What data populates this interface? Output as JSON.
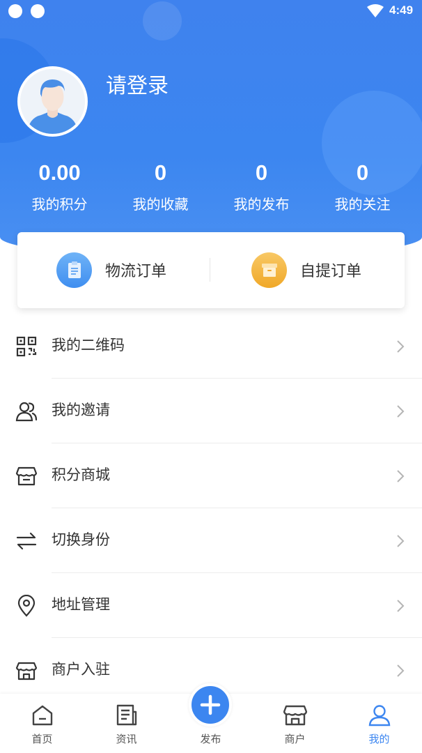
{
  "status_bar": {
    "time": "4:49"
  },
  "profile": {
    "login_text": "请登录"
  },
  "stats": [
    {
      "value": "0.00",
      "label": "我的积分"
    },
    {
      "value": "0",
      "label": "我的收藏"
    },
    {
      "value": "0",
      "label": "我的发布"
    },
    {
      "value": "0",
      "label": "我的关注"
    }
  ],
  "orders": {
    "logistics": {
      "label": "物流订单",
      "icon": "clipboard-icon",
      "color": "#4a9cf0"
    },
    "pickup": {
      "label": "自提订单",
      "icon": "box-icon",
      "color": "#f2b33d"
    }
  },
  "menu": [
    {
      "label": "我的二维码",
      "icon": "qrcode-icon"
    },
    {
      "label": "我的邀请",
      "icon": "users-icon"
    },
    {
      "label": "积分商城",
      "icon": "store-icon"
    },
    {
      "label": "切换身份",
      "icon": "swap-icon"
    },
    {
      "label": "地址管理",
      "icon": "location-pin-icon"
    },
    {
      "label": "商户入驻",
      "icon": "shop-icon"
    }
  ],
  "bottom_nav": [
    {
      "label": "首页",
      "icon": "home-icon"
    },
    {
      "label": "资讯",
      "icon": "news-icon"
    },
    {
      "label": "发布",
      "icon": "plus-icon"
    },
    {
      "label": "商户",
      "icon": "shop-icon"
    },
    {
      "label": "我的",
      "icon": "user-icon",
      "active": true
    }
  ],
  "colors": {
    "primary": "#3c86f0",
    "text": "#333333",
    "pickup_icon_bg": "#f2b33d",
    "logistics_icon_bg": "#4a9cf0"
  }
}
